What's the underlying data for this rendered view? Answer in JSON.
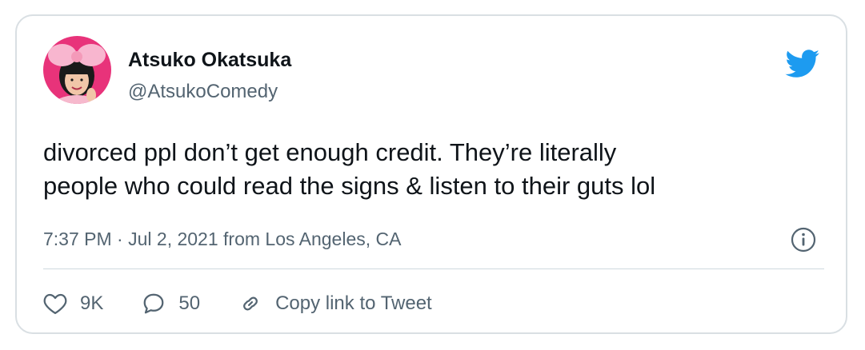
{
  "user": {
    "display_name": "Atsuko Okatsuka",
    "handle": "@AtsukoComedy",
    "avatar_icon": "profile-photo-pink-bow"
  },
  "brand": {
    "icon": "twitter-bird-icon",
    "color": "#1d9bf0"
  },
  "tweet": {
    "text_line1": "divorced ppl don’t get enough credit. They’re literally",
    "text_line2": "people who could read the signs & listen to their guts lol"
  },
  "meta": {
    "time": "7:37 PM",
    "separator": " · ",
    "date": "Jul 2, 2021",
    "source_prefix": " from ",
    "location": "Los Angeles, CA"
  },
  "actions": {
    "like_count": "9K",
    "reply_count": "50",
    "copy_link_label": "Copy link to Tweet"
  },
  "colors": {
    "text_primary": "#0f1419",
    "text_secondary": "#536471",
    "border": "#d9dfe3",
    "avatar_background": "#e8337a"
  }
}
